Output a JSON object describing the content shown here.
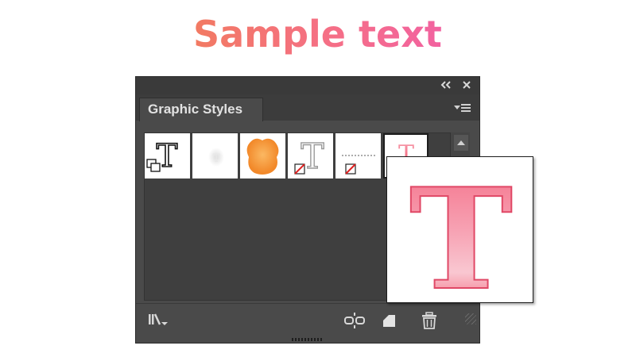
{
  "sample_text": "Sample text",
  "panel": {
    "title_controls": {
      "collapse_icon": "double-chevron-left",
      "close_icon": "close"
    },
    "tab_label": "Graphic Styles",
    "menu_icon": "panel-menu",
    "swatches": [
      {
        "name": "default-graphic-style",
        "selected": false
      },
      {
        "name": "white-glow-style",
        "selected": false
      },
      {
        "name": "orange-blob-style",
        "selected": false
      },
      {
        "name": "outlined-t-style",
        "selected": false
      },
      {
        "name": "dotted-line-style",
        "selected": false
      },
      {
        "name": "pink-t-style",
        "selected": true
      }
    ],
    "preview_glyph": "T",
    "swatch_glyph": "T",
    "bottom_icons": [
      "graphic-style-libraries-menu",
      "break-link-to-graphic-style",
      "new-graphic-style",
      "delete-graphic-style"
    ],
    "colors": {
      "panel_bg": "#4a4a4a",
      "accent_pink": "#f5617a",
      "accent_orange": "#f5963a"
    }
  }
}
